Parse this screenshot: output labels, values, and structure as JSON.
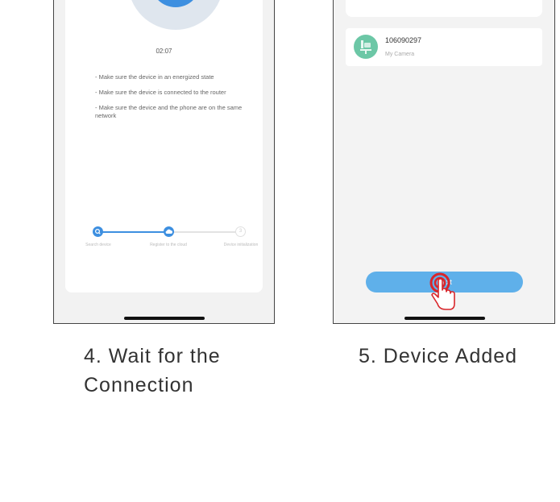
{
  "step4": {
    "timer": "02:07",
    "tips": [
      "- Make sure the device in an energized state",
      "- Make sure the device is connected to the router",
      "- Make sure the device and the phone are on the same network"
    ],
    "steps": [
      {
        "label": "Search device",
        "state": "done"
      },
      {
        "label": "Register to the cloud",
        "state": "active"
      },
      {
        "label": "Device initialization",
        "state": "pending"
      }
    ],
    "caption_line1": "4. Wait for the",
    "caption_line2": "Connection"
  },
  "step5": {
    "device": {
      "id": "106090297",
      "name": "My Camera"
    },
    "next_label": "Next",
    "caption": "5. Device Added"
  },
  "colors": {
    "accent": "#3d8fe0",
    "button": "#5fb0ea",
    "avatar": "#6cc7a6",
    "tap": "#d9252a"
  }
}
